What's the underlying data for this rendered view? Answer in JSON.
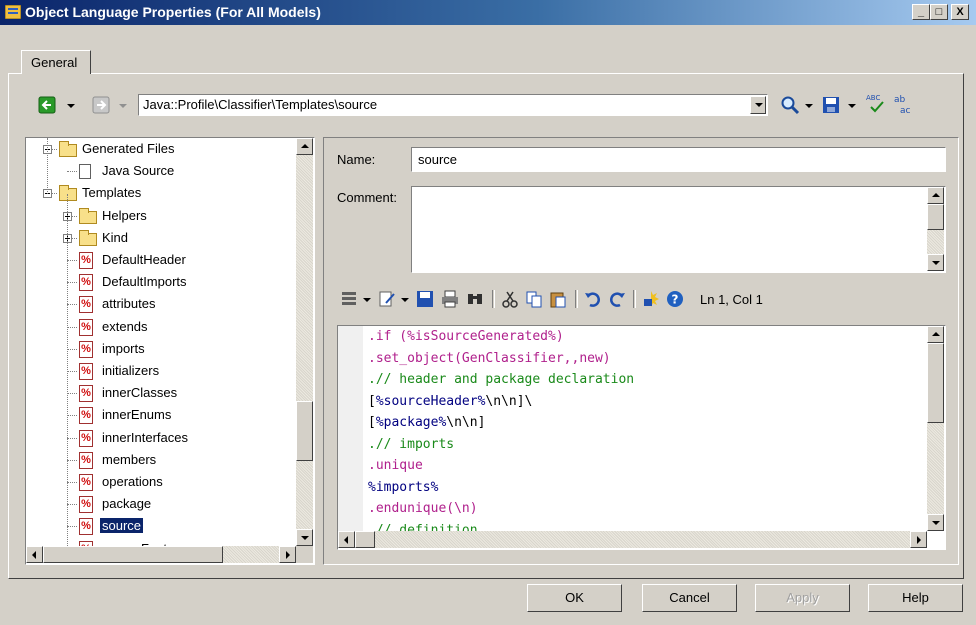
{
  "window": {
    "title": "Object Language Properties (For All Models)",
    "controls": {
      "minimize": "_",
      "maximize": "□",
      "close": "X"
    }
  },
  "tabs": [
    {
      "label": "General",
      "active": true
    }
  ],
  "nav": {
    "path": "Java::Profile\\Classifier\\Templates\\source"
  },
  "tree": {
    "items": [
      {
        "label": "Generated Files",
        "type": "folder",
        "expanded": true,
        "level": 0
      },
      {
        "label": "Java Source",
        "type": "document",
        "level": 1
      },
      {
        "label": "Templates",
        "type": "folder",
        "expanded": true,
        "level": 0
      },
      {
        "label": "Helpers",
        "type": "folder",
        "expanded": false,
        "level": 1
      },
      {
        "label": "Kind",
        "type": "folder",
        "expanded": false,
        "level": 1
      },
      {
        "label": "DefaultHeader",
        "type": "template",
        "level": 1
      },
      {
        "label": "DefaultImports",
        "type": "template",
        "level": 1
      },
      {
        "label": "attributes",
        "type": "template",
        "level": 1
      },
      {
        "label": "extends",
        "type": "template",
        "level": 1
      },
      {
        "label": "imports",
        "type": "template",
        "level": 1
      },
      {
        "label": "initializers",
        "type": "template",
        "level": 1
      },
      {
        "label": "innerClasses",
        "type": "template",
        "level": 1
      },
      {
        "label": "innerEnums",
        "type": "template",
        "level": 1
      },
      {
        "label": "innerInterfaces",
        "type": "template",
        "level": 1
      },
      {
        "label": "members",
        "type": "template",
        "level": 1
      },
      {
        "label": "operations",
        "type": "template",
        "level": 1
      },
      {
        "label": "package",
        "type": "template",
        "level": 1
      },
      {
        "label": "source",
        "type": "template",
        "level": 1,
        "selected": true
      },
      {
        "label": "sourceFooter",
        "type": "template",
        "level": 1
      }
    ]
  },
  "form": {
    "name_label": "Name:",
    "name_value": "source",
    "comment_label": "Comment:",
    "comment_value": ""
  },
  "editor": {
    "status": "Ln 1, Col 1",
    "lines": [
      {
        "text": ".if (%isSourceGenerated%)",
        "kind": "kw"
      },
      {
        "text": ".set_object(GenClassifier,,new)",
        "kind": "kw"
      },
      {
        "text": ".// header and package declaration",
        "kind": "cm"
      },
      {
        "text": "[%sourceHeader%\\n\\n]\\",
        "kind": "mix1"
      },
      {
        "text": "[%package%\\n\\n]",
        "kind": "mix2"
      },
      {
        "text": ".// imports",
        "kind": "cm"
      },
      {
        "text": ".unique",
        "kind": "kw"
      },
      {
        "text": "%imports%",
        "kind": "vr"
      },
      {
        "text": ".endunique(\\n)",
        "kind": "kw"
      },
      {
        "text": ".// definition",
        "kind": "cm"
      }
    ]
  },
  "buttons": {
    "ok": "OK",
    "cancel": "Cancel",
    "apply": "Apply",
    "help": "Help"
  },
  "colors": {
    "title_start": "#0a246a",
    "title_end": "#a6caf0",
    "selection": "#0a246a",
    "keyword": "#b0208c",
    "comment": "#1a8a1a"
  }
}
